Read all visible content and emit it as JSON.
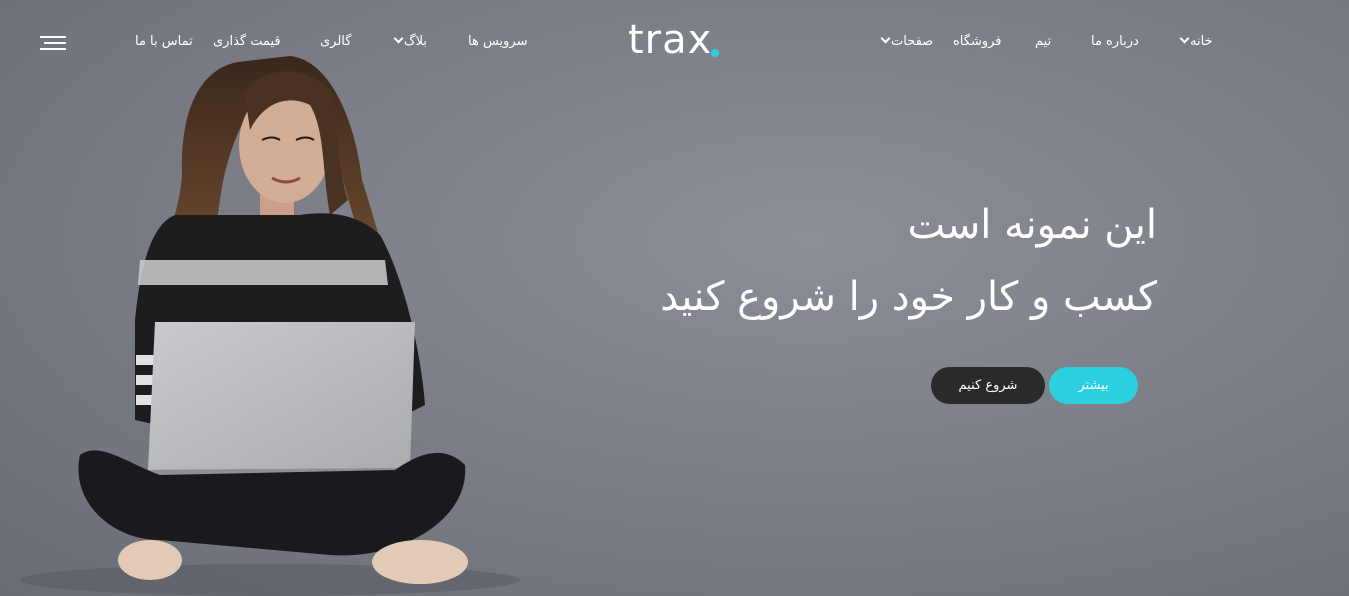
{
  "logo": {
    "text": "trax",
    "dot_color": "#2ccfe0"
  },
  "nav": {
    "home": "خانه",
    "about": "درباره ما",
    "team": "تیم",
    "shop": "فروشگاه",
    "pages": "صفحات",
    "services": "سرویس ها",
    "blog": "بلاگ",
    "gallery": "گالری",
    "pricing": "قیمت گذاری",
    "contact": "تماس با ما",
    "menu_icon": "hamburger-menu-icon"
  },
  "hero": {
    "line1": "این نمونه است",
    "line2": "کسب و کار خود را شروع کنید",
    "more_label": "بیشتر",
    "start_label": "شروع کنیم",
    "accent_color": "#2ccfe0",
    "dark_button_color": "#2a2a2c"
  }
}
